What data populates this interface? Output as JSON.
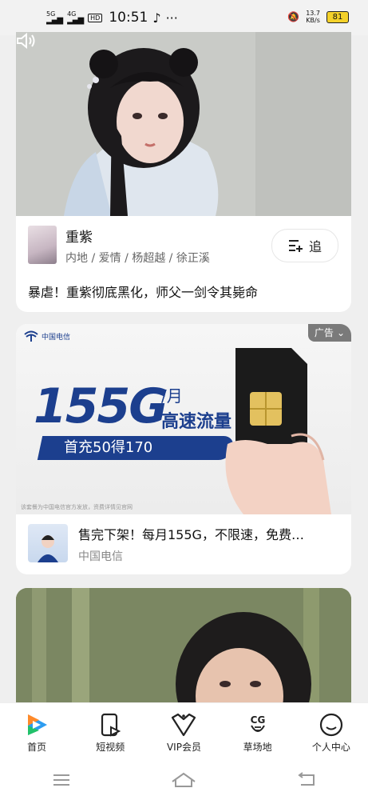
{
  "status_bar": {
    "signal1": "5G",
    "signal2": "4G",
    "hd": "HD",
    "time": "10:51",
    "more": "···",
    "net_speed": "13.7",
    "net_unit": "KB/s",
    "battery": "81"
  },
  "feed": [
    {
      "title": "重紫",
      "meta": "内地 / 爱情 / 杨超越 / 徐正溪",
      "follow_label": "追",
      "caption": "暴虐！重紫彻底黑化，师父一剑令其毙命"
    },
    {
      "ad_tag": "广告",
      "telecom_logo_text": "中国电信",
      "big_number": "155G",
      "per_month": "/月",
      "speed_label": "高速流量",
      "promo": "首充50得170",
      "fine_print": "该套餐为中国电信官方发放，资费详情见官网",
      "title": "售完下架！每月155G，不限速，免费…",
      "brand": "中国电信"
    }
  ],
  "tabs": [
    {
      "label": "首页",
      "icon": "home-logo-icon"
    },
    {
      "label": "短视频",
      "icon": "short-video-icon"
    },
    {
      "label": "VIP会员",
      "icon": "vip-icon"
    },
    {
      "label": "草场地",
      "icon": "cg-icon"
    },
    {
      "label": "个人中心",
      "icon": "profile-icon"
    }
  ],
  "nav": [
    "menu-icon",
    "home-icon",
    "back-icon"
  ]
}
